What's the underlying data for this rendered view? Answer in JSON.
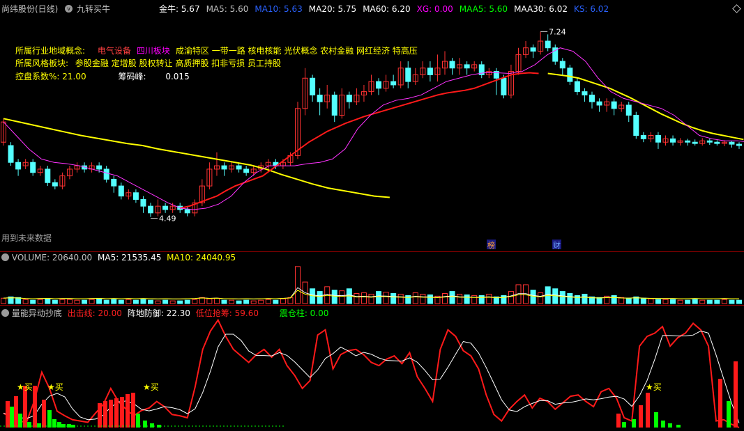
{
  "header": {
    "stock_name": "尚纬股份(日线)",
    "indicator_name": "九转买牛",
    "values": [
      {
        "label": "金牛: 5.67",
        "color": "#ffffff"
      },
      {
        "label": "MA5: 5.60",
        "color": "#c0c0c0"
      },
      {
        "label": "MA10: 5.63",
        "color": "#2a62ff"
      },
      {
        "label": "MA20: 5.75",
        "color": "#ffffff"
      },
      {
        "label": "MA60: 6.20",
        "color": "#ffffff"
      },
      {
        "label": "XG: 0.00",
        "color": "#ff00ff"
      },
      {
        "label": "MAA5: 5.60",
        "color": "#00ff00"
      },
      {
        "label": "MAA30: 6.02",
        "color": "#ffffff"
      },
      {
        "label": "KS: 6.02",
        "color": "#2a62ff"
      }
    ]
  },
  "info": {
    "industry_label": "所属行业地域概念:",
    "industry_items": [
      {
        "text": "电气设备",
        "color": "#ff4040"
      },
      {
        "text": "四川板块",
        "color": "#ff00ff"
      },
      {
        "text": "成渝特区 一带一路 核电核能 光伏概念 农村金融 网红经济 特高压",
        "color": "#ffff00"
      }
    ],
    "style_label": "所属风格板块:",
    "style_items": "参股金融 定增股 股权转让 高质押股 扣非亏损 员工持股",
    "control_label": "控盘系数%:",
    "control_value": "21.00",
    "chip_label": "筹码峰:",
    "chip_value": "0.015"
  },
  "price_chart": {
    "high_label": "7.24",
    "low_label": "4.49",
    "future_data_note": "用到未来数据",
    "badges": [
      {
        "text": "榜"
      },
      {
        "text": "财"
      }
    ]
  },
  "volume_panel": {
    "title": "VOLUME: 20640.00",
    "ma5": "MA5: 21535.45",
    "ma10": "MA10: 24040.95"
  },
  "energy_panel": {
    "title": "量能异动抄底",
    "exit_line": "出击线: 20.00",
    "defense": "阵地防御: 22.30",
    "low_absorb": "低位抢筹: 59.60",
    "empty_column": "震仓柱: 0.00",
    "buy_label": "买"
  },
  "chart_data": {
    "type": "candlestick",
    "ylim": [
      4.3,
      7.4
    ],
    "candles": [
      [
        5.6,
        5.9,
        5.55,
        5.95
      ],
      [
        5.55,
        5.3,
        5.25,
        5.6
      ],
      [
        5.3,
        5.2,
        5.1,
        5.35
      ],
      [
        5.25,
        5.3,
        5.2,
        5.35
      ],
      [
        5.3,
        5.15,
        5.1,
        5.35
      ],
      [
        5.15,
        5.2,
        5.1,
        5.25
      ],
      [
        5.2,
        5.0,
        4.95,
        5.25
      ],
      [
        5.0,
        4.95,
        4.9,
        5.05
      ],
      [
        4.95,
        5.1,
        4.9,
        5.15
      ],
      [
        5.1,
        5.2,
        5.05,
        5.25
      ],
      [
        5.2,
        5.25,
        5.15,
        5.3
      ],
      [
        5.25,
        5.2,
        5.15,
        5.3
      ],
      [
        5.2,
        5.25,
        5.15,
        5.3
      ],
      [
        5.25,
        5.2,
        5.15,
        5.3
      ],
      [
        5.2,
        5.05,
        5.0,
        5.25
      ],
      [
        5.05,
        4.95,
        4.85,
        5.1
      ],
      [
        4.95,
        4.8,
        4.75,
        5.0
      ],
      [
        4.8,
        4.85,
        4.75,
        4.9
      ],
      [
        4.85,
        4.75,
        4.7,
        4.9
      ],
      [
        4.75,
        4.65,
        4.55,
        4.8
      ],
      [
        4.65,
        4.55,
        4.49,
        4.7
      ],
      [
        4.55,
        4.65,
        4.5,
        4.75
      ],
      [
        4.65,
        4.6,
        4.55,
        4.7
      ],
      [
        4.6,
        4.65,
        4.55,
        4.7
      ],
      [
        4.65,
        4.6,
        4.55,
        4.7
      ],
      [
        4.6,
        4.55,
        4.5,
        4.65
      ],
      [
        4.55,
        4.7,
        4.5,
        4.75
      ],
      [
        4.7,
        4.95,
        4.65,
        5.05
      ],
      [
        4.95,
        5.2,
        4.9,
        5.3
      ],
      [
        5.2,
        5.25,
        5.1,
        5.45
      ],
      [
        5.25,
        5.2,
        5.1,
        5.3
      ],
      [
        5.2,
        5.25,
        5.15,
        5.3
      ],
      [
        5.25,
        5.2,
        5.15,
        5.3
      ],
      [
        5.2,
        5.15,
        5.1,
        5.25
      ],
      [
        5.15,
        5.2,
        5.1,
        5.25
      ],
      [
        5.2,
        5.25,
        5.15,
        5.3
      ],
      [
        5.25,
        5.3,
        5.2,
        5.35
      ],
      [
        5.3,
        5.25,
        5.2,
        5.35
      ],
      [
        5.25,
        5.3,
        5.2,
        5.35
      ],
      [
        5.3,
        5.4,
        5.25,
        5.45
      ],
      [
        5.4,
        6.1,
        5.35,
        6.2
      ],
      [
        6.1,
        6.55,
        6.0,
        6.7
      ],
      [
        6.55,
        6.3,
        6.2,
        6.6
      ],
      [
        6.3,
        6.2,
        6.0,
        6.4
      ],
      [
        6.2,
        6.3,
        6.1,
        6.45
      ],
      [
        6.3,
        6.0,
        5.9,
        6.35
      ],
      [
        6.0,
        6.3,
        5.95,
        6.4
      ],
      [
        6.3,
        6.2,
        6.1,
        6.35
      ],
      [
        6.2,
        6.3,
        6.15,
        6.4
      ],
      [
        6.3,
        6.35,
        6.2,
        6.45
      ],
      [
        6.35,
        6.5,
        6.3,
        6.6
      ],
      [
        6.5,
        6.4,
        6.3,
        6.55
      ],
      [
        6.4,
        6.5,
        6.35,
        6.6
      ],
      [
        6.5,
        6.45,
        6.4,
        6.6
      ],
      [
        6.45,
        6.7,
        6.4,
        6.8
      ],
      [
        6.7,
        6.5,
        6.4,
        6.8
      ],
      [
        6.5,
        6.6,
        6.45,
        6.7
      ],
      [
        6.6,
        6.7,
        6.55,
        6.8
      ],
      [
        6.7,
        6.6,
        6.5,
        6.8
      ],
      [
        6.6,
        6.7,
        6.5,
        6.9
      ],
      [
        6.7,
        6.8,
        6.6,
        6.95
      ],
      [
        6.8,
        6.7,
        6.6,
        6.85
      ],
      [
        6.7,
        6.75,
        6.6,
        6.85
      ],
      [
        6.75,
        6.7,
        6.6,
        6.8
      ],
      [
        6.7,
        6.75,
        6.65,
        6.8
      ],
      [
        6.75,
        6.6,
        6.55,
        6.8
      ],
      [
        6.6,
        6.65,
        6.55,
        6.7
      ],
      [
        6.65,
        6.55,
        6.3,
        6.7
      ],
      [
        6.55,
        6.3,
        6.25,
        6.6
      ],
      [
        6.3,
        6.65,
        6.25,
        6.75
      ],
      [
        6.65,
        6.9,
        6.6,
        7.0
      ],
      [
        6.9,
        7.0,
        6.85,
        7.1
      ],
      [
        7.0,
        6.95,
        6.85,
        7.05
      ],
      [
        6.95,
        7.1,
        6.9,
        7.24
      ],
      [
        7.1,
        7.0,
        6.95,
        7.2
      ],
      [
        7.0,
        6.8,
        6.75,
        7.05
      ],
      [
        6.8,
        6.7,
        6.6,
        6.85
      ],
      [
        6.7,
        6.5,
        6.45,
        6.75
      ],
      [
        6.5,
        6.35,
        6.3,
        6.55
      ],
      [
        6.35,
        6.3,
        6.2,
        6.4
      ],
      [
        6.3,
        6.2,
        6.1,
        6.35
      ],
      [
        6.2,
        6.15,
        6.05,
        6.25
      ],
      [
        6.15,
        6.2,
        6.05,
        6.25
      ],
      [
        6.2,
        6.1,
        6.0,
        6.25
      ],
      [
        6.1,
        6.15,
        6.05,
        6.2
      ],
      [
        6.15,
        6.0,
        5.9,
        6.2
      ],
      [
        6.0,
        5.7,
        5.65,
        6.05
      ],
      [
        5.7,
        5.65,
        5.6,
        5.75
      ],
      [
        5.65,
        5.7,
        5.6,
        5.75
      ],
      [
        5.7,
        5.6,
        5.5,
        5.75
      ],
      [
        5.6,
        5.65,
        5.55,
        5.7
      ],
      [
        5.65,
        5.6,
        5.55,
        5.7
      ],
      [
        5.6,
        5.62,
        5.55,
        5.66
      ],
      [
        5.62,
        5.6,
        5.55,
        5.65
      ],
      [
        5.6,
        5.58,
        5.55,
        5.64
      ],
      [
        5.58,
        5.62,
        5.55,
        5.66
      ],
      [
        5.62,
        5.6,
        5.56,
        5.65
      ],
      [
        5.6,
        5.58,
        5.55,
        5.63
      ],
      [
        5.58,
        5.6,
        5.54,
        5.63
      ],
      [
        5.6,
        5.57,
        5.52,
        5.62
      ],
      [
        5.57,
        5.55,
        5.5,
        5.6
      ]
    ],
    "ma_yellow": [
      5.95,
      5.9,
      5.85,
      5.8,
      5.75,
      5.7,
      5.66,
      5.62,
      5.58,
      5.55,
      5.5,
      5.46,
      5.42,
      5.38,
      5.34,
      5.3,
      5.26,
      5.2,
      5.12,
      5.05,
      4.98,
      4.92,
      4.88,
      4.84,
      4.8,
      4.78
    ],
    "ma_red": [
      4.62,
      4.65,
      4.7,
      4.75,
      4.8,
      4.88,
      4.95,
      5.0,
      5.05,
      5.1,
      5.2,
      5.3,
      5.4,
      5.5,
      5.6,
      5.68,
      5.76,
      5.82,
      5.88,
      5.93,
      5.98,
      6.02,
      6.06,
      6.1,
      6.14,
      6.18,
      6.22,
      6.26,
      6.3,
      6.33,
      6.35,
      6.37,
      6.4,
      6.45,
      6.5,
      6.55,
      6.6,
      6.62,
      6.63,
      6.62
    ],
    "ma_yellow2": [
      6.62,
      6.6,
      6.58,
      6.55,
      6.5,
      6.45,
      6.4,
      6.33,
      6.26,
      6.18,
      6.1,
      6.02,
      5.95,
      5.88,
      5.82,
      5.77,
      5.73,
      5.7,
      5.67,
      5.64
    ],
    "ma_magenta": [
      5.9,
      5.7,
      5.5,
      5.35,
      5.3,
      5.28,
      5.25,
      5.2,
      5.15,
      5.1,
      5.0,
      4.9,
      4.8,
      4.7,
      4.62,
      4.6,
      4.62,
      4.68,
      4.8,
      5.0,
      5.15,
      5.25,
      5.25,
      5.25,
      5.28,
      5.3,
      5.35,
      5.5,
      5.8,
      6.0,
      6.15,
      6.22,
      6.25,
      6.3,
      6.4,
      6.5,
      6.55,
      6.6,
      6.63,
      6.63,
      6.62,
      6.65,
      6.75,
      6.9,
      7.0,
      6.95,
      6.8,
      6.55,
      6.35,
      6.25,
      6.2,
      6.15,
      6.1,
      6.0,
      5.85,
      5.7,
      5.65,
      5.62,
      5.62,
      5.6
    ],
    "volume": [
      8,
      10,
      9,
      6,
      5,
      6,
      7,
      5,
      6,
      6,
      5,
      5,
      6,
      7,
      5,
      6,
      5,
      6,
      5,
      6,
      5,
      4,
      5,
      4,
      4,
      5,
      6,
      9,
      7,
      8,
      5,
      5,
      4,
      5,
      4,
      5,
      6,
      5,
      7,
      9,
      55,
      32,
      22,
      18,
      25,
      20,
      19,
      22,
      15,
      16,
      14,
      18,
      17,
      15,
      14,
      12,
      16,
      14,
      13,
      11,
      15,
      18,
      14,
      13,
      12,
      12,
      14,
      10,
      12,
      18,
      28,
      28,
      20,
      16,
      25,
      22,
      18,
      15,
      12,
      14,
      10,
      9,
      11,
      12,
      9,
      8,
      10,
      8,
      7,
      6,
      6,
      6,
      5,
      5,
      6,
      5,
      5,
      5,
      6,
      5,
      5
    ],
    "energy_red": [
      22,
      15,
      10,
      8,
      40,
      85,
      60,
      25,
      18,
      12,
      10,
      8,
      22,
      35,
      60,
      40,
      28,
      18,
      26,
      30,
      40,
      32,
      20,
      18,
      15,
      62,
      120,
      148,
      165,
      140,
      120,
      110,
      100,
      112,
      120,
      108,
      120,
      95,
      80,
      60,
      72,
      142,
      150,
      90,
      112,
      118,
      120,
      112,
      100,
      95,
      105,
      110,
      98,
      115,
      78,
      60,
      40,
      120,
      150,
      140,
      118,
      110,
      90,
      50,
      20,
      10,
      28,
      40,
      50,
      30,
      45,
      40,
      28,
      38,
      48,
      50,
      40,
      32,
      55,
      60,
      45,
      15,
      10,
      125,
      140,
      145,
      155,
      125,
      138,
      145,
      160,
      150,
      125,
      10,
      12,
      5,
      0
    ]
  }
}
